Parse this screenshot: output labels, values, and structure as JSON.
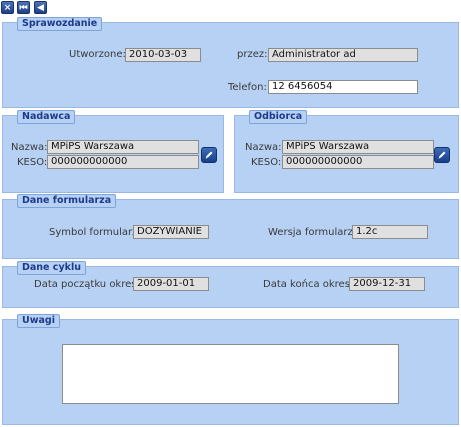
{
  "toolbar": {
    "close_icon": "×",
    "first_icon": "⏮",
    "prev_icon": "◀"
  },
  "sprawozdanie": {
    "title": "Sprawozdanie",
    "created_label": "Utworzone:",
    "created_value": "2010-03-03",
    "by_label": "przez:",
    "by_value": "Administrator ad",
    "phone_label": "Telefon:",
    "phone_value": "12 6456054"
  },
  "nadawca": {
    "title": "Nadawca",
    "name_label": "Nazwa:",
    "name_value": "MPiPS Warszawa",
    "keso_label": "KESO:",
    "keso_value": "000000000000"
  },
  "odbiorca": {
    "title": "Odbiorca",
    "name_label": "Nazwa:",
    "name_value": "MPiPS Warszawa",
    "keso_label": "KESO:",
    "keso_value": "000000000000"
  },
  "formularz": {
    "title": "Dane formularza",
    "symbol_label": "Symbol formularza:",
    "symbol_value": "DOŻYWIANIE",
    "version_label": "Wersja formularza:",
    "version_value": "1.2c"
  },
  "cykl": {
    "title": "Dane cyklu",
    "start_label": "Data początku okresu:",
    "start_value": "2009-01-01",
    "end_label": "Data końca okresu:",
    "end_value": "2009-12-31"
  },
  "uwagi": {
    "title": "Uwagi",
    "value": ""
  },
  "colors": {
    "panel": "#b6d1f4",
    "title_text": "#1e3a8a",
    "field": "#e0e0e0"
  }
}
